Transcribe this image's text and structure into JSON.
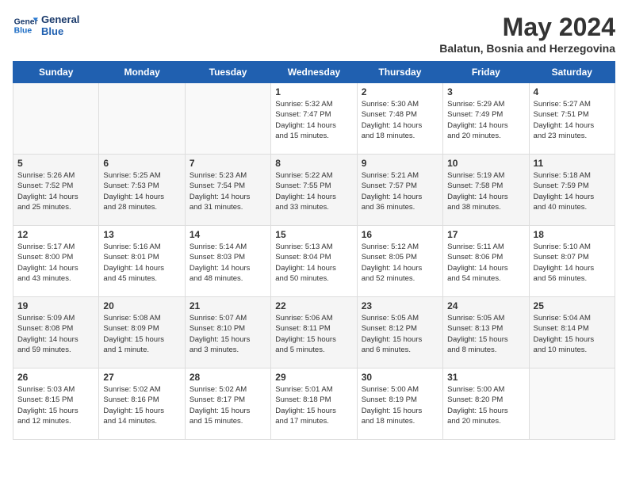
{
  "header": {
    "logo_line1": "General",
    "logo_line2": "Blue",
    "month": "May 2024",
    "location": "Balatun, Bosnia and Herzegovina"
  },
  "days_of_week": [
    "Sunday",
    "Monday",
    "Tuesday",
    "Wednesday",
    "Thursday",
    "Friday",
    "Saturday"
  ],
  "weeks": [
    [
      {
        "day": "",
        "info": ""
      },
      {
        "day": "",
        "info": ""
      },
      {
        "day": "",
        "info": ""
      },
      {
        "day": "1",
        "info": "Sunrise: 5:32 AM\nSunset: 7:47 PM\nDaylight: 14 hours\nand 15 minutes."
      },
      {
        "day": "2",
        "info": "Sunrise: 5:30 AM\nSunset: 7:48 PM\nDaylight: 14 hours\nand 18 minutes."
      },
      {
        "day": "3",
        "info": "Sunrise: 5:29 AM\nSunset: 7:49 PM\nDaylight: 14 hours\nand 20 minutes."
      },
      {
        "day": "4",
        "info": "Sunrise: 5:27 AM\nSunset: 7:51 PM\nDaylight: 14 hours\nand 23 minutes."
      }
    ],
    [
      {
        "day": "5",
        "info": "Sunrise: 5:26 AM\nSunset: 7:52 PM\nDaylight: 14 hours\nand 25 minutes."
      },
      {
        "day": "6",
        "info": "Sunrise: 5:25 AM\nSunset: 7:53 PM\nDaylight: 14 hours\nand 28 minutes."
      },
      {
        "day": "7",
        "info": "Sunrise: 5:23 AM\nSunset: 7:54 PM\nDaylight: 14 hours\nand 31 minutes."
      },
      {
        "day": "8",
        "info": "Sunrise: 5:22 AM\nSunset: 7:55 PM\nDaylight: 14 hours\nand 33 minutes."
      },
      {
        "day": "9",
        "info": "Sunrise: 5:21 AM\nSunset: 7:57 PM\nDaylight: 14 hours\nand 36 minutes."
      },
      {
        "day": "10",
        "info": "Sunrise: 5:19 AM\nSunset: 7:58 PM\nDaylight: 14 hours\nand 38 minutes."
      },
      {
        "day": "11",
        "info": "Sunrise: 5:18 AM\nSunset: 7:59 PM\nDaylight: 14 hours\nand 40 minutes."
      }
    ],
    [
      {
        "day": "12",
        "info": "Sunrise: 5:17 AM\nSunset: 8:00 PM\nDaylight: 14 hours\nand 43 minutes."
      },
      {
        "day": "13",
        "info": "Sunrise: 5:16 AM\nSunset: 8:01 PM\nDaylight: 14 hours\nand 45 minutes."
      },
      {
        "day": "14",
        "info": "Sunrise: 5:14 AM\nSunset: 8:03 PM\nDaylight: 14 hours\nand 48 minutes."
      },
      {
        "day": "15",
        "info": "Sunrise: 5:13 AM\nSunset: 8:04 PM\nDaylight: 14 hours\nand 50 minutes."
      },
      {
        "day": "16",
        "info": "Sunrise: 5:12 AM\nSunset: 8:05 PM\nDaylight: 14 hours\nand 52 minutes."
      },
      {
        "day": "17",
        "info": "Sunrise: 5:11 AM\nSunset: 8:06 PM\nDaylight: 14 hours\nand 54 minutes."
      },
      {
        "day": "18",
        "info": "Sunrise: 5:10 AM\nSunset: 8:07 PM\nDaylight: 14 hours\nand 56 minutes."
      }
    ],
    [
      {
        "day": "19",
        "info": "Sunrise: 5:09 AM\nSunset: 8:08 PM\nDaylight: 14 hours\nand 59 minutes."
      },
      {
        "day": "20",
        "info": "Sunrise: 5:08 AM\nSunset: 8:09 PM\nDaylight: 15 hours\nand 1 minute."
      },
      {
        "day": "21",
        "info": "Sunrise: 5:07 AM\nSunset: 8:10 PM\nDaylight: 15 hours\nand 3 minutes."
      },
      {
        "day": "22",
        "info": "Sunrise: 5:06 AM\nSunset: 8:11 PM\nDaylight: 15 hours\nand 5 minutes."
      },
      {
        "day": "23",
        "info": "Sunrise: 5:05 AM\nSunset: 8:12 PM\nDaylight: 15 hours\nand 6 minutes."
      },
      {
        "day": "24",
        "info": "Sunrise: 5:05 AM\nSunset: 8:13 PM\nDaylight: 15 hours\nand 8 minutes."
      },
      {
        "day": "25",
        "info": "Sunrise: 5:04 AM\nSunset: 8:14 PM\nDaylight: 15 hours\nand 10 minutes."
      }
    ],
    [
      {
        "day": "26",
        "info": "Sunrise: 5:03 AM\nSunset: 8:15 PM\nDaylight: 15 hours\nand 12 minutes."
      },
      {
        "day": "27",
        "info": "Sunrise: 5:02 AM\nSunset: 8:16 PM\nDaylight: 15 hours\nand 14 minutes."
      },
      {
        "day": "28",
        "info": "Sunrise: 5:02 AM\nSunset: 8:17 PM\nDaylight: 15 hours\nand 15 minutes."
      },
      {
        "day": "29",
        "info": "Sunrise: 5:01 AM\nSunset: 8:18 PM\nDaylight: 15 hours\nand 17 minutes."
      },
      {
        "day": "30",
        "info": "Sunrise: 5:00 AM\nSunset: 8:19 PM\nDaylight: 15 hours\nand 18 minutes."
      },
      {
        "day": "31",
        "info": "Sunrise: 5:00 AM\nSunset: 8:20 PM\nDaylight: 15 hours\nand 20 minutes."
      },
      {
        "day": "",
        "info": ""
      }
    ]
  ]
}
